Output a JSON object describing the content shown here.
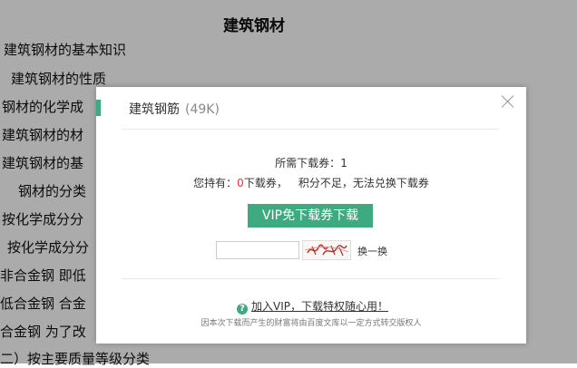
{
  "document": {
    "title": "建筑钢材",
    "lines": [
      "建筑钢材的基本知识",
      "建筑钢材的性质",
      "钢材的化学成",
      "建筑钢材的材",
      "建筑钢材的基",
      "钢材的分类",
      "按化学成分分",
      "按化学成分分",
      "非合金钢 即低",
      "低合金钢 合金",
      "合金钢 为了改",
      "二）按主要质量等级分类"
    ]
  },
  "modal": {
    "title": "建筑钢筋",
    "file_size": "(49K)",
    "close_icon": "close-icon",
    "required_label": "所需下载券：",
    "required_value": "1",
    "hold_prefix": "您持有：",
    "hold_count": "0",
    "hold_suffix": "下载券，",
    "points_text": "积分不足，无法兑换下载券",
    "vip_button": "VIP免下载券下载",
    "captcha_input_value": "",
    "refresh_label": "换一换",
    "help_icon": "question-circle-icon",
    "help_link": "加入VIP，下载特权随心用！",
    "footnote": "因本次下载而产生的财富将由百度文库以一定方式转交版权人"
  },
  "colors": {
    "accent": "#3daa7f",
    "warning": "#e33333",
    "overlay": "rgba(0,0,0,0.33)"
  }
}
